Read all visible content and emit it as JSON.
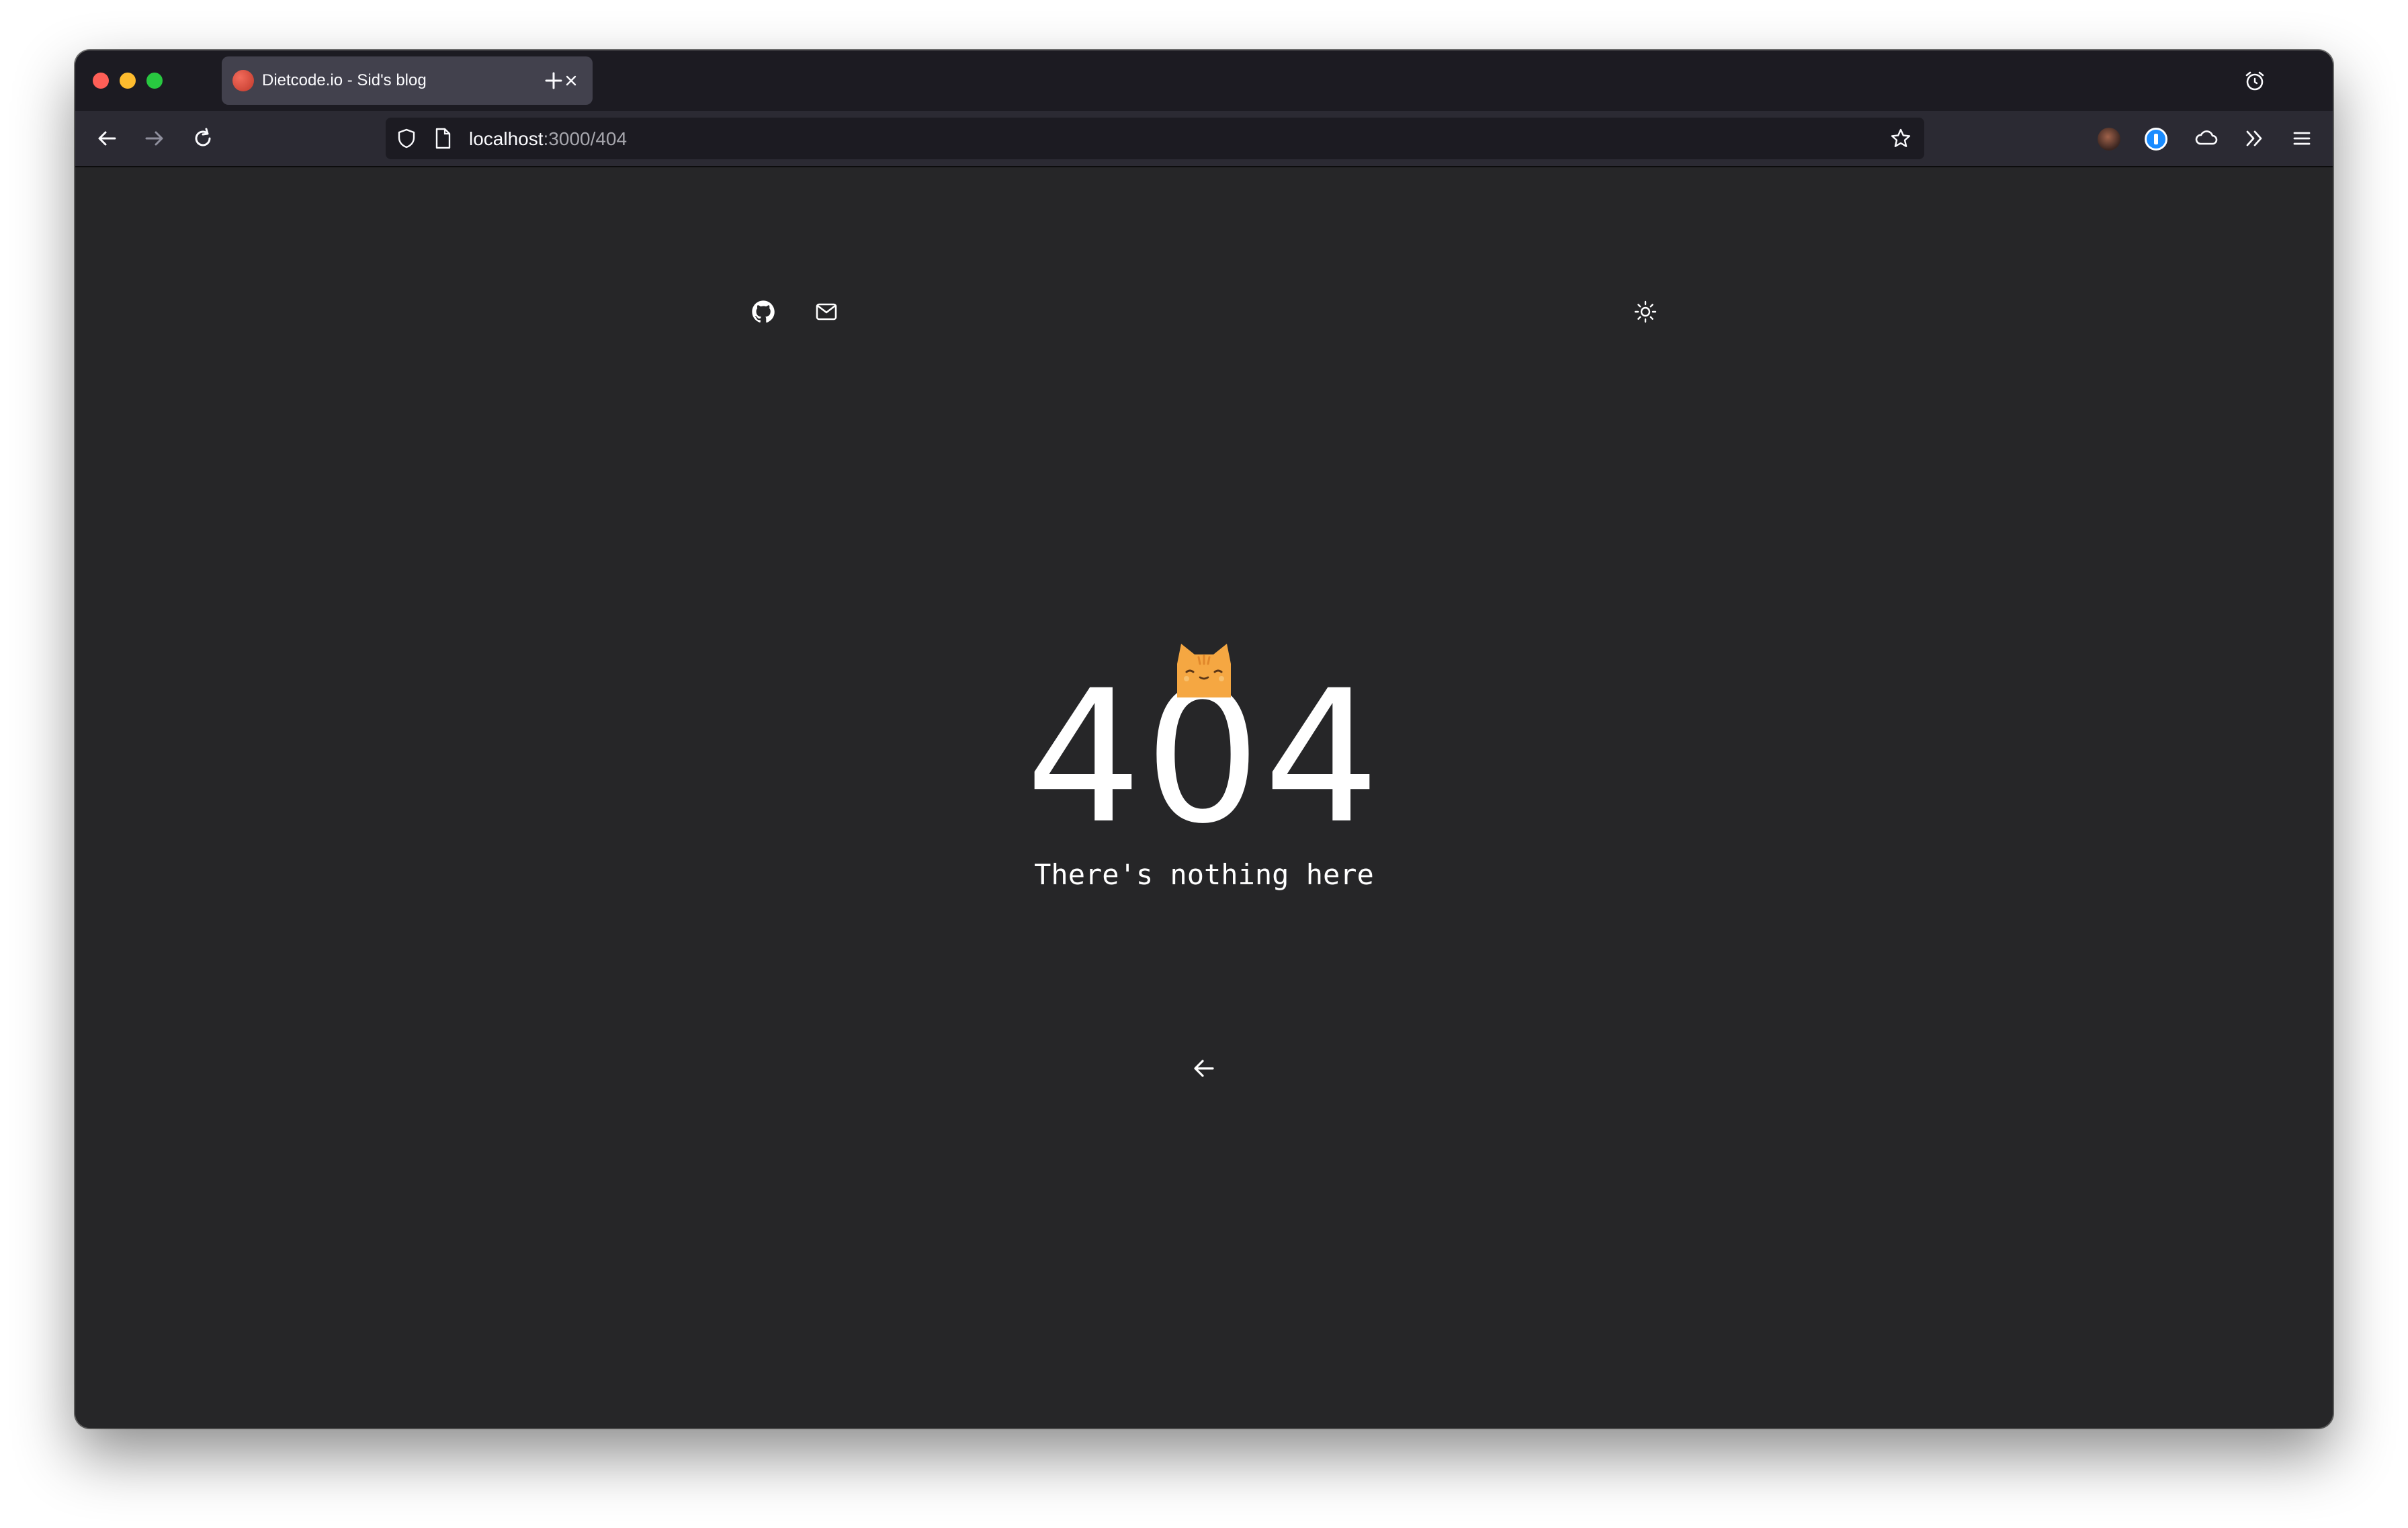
{
  "browser": {
    "tab": {
      "title": "Dietcode.io - Sid's blog",
      "favicon": "blog-favicon"
    },
    "toolbar": {
      "back": "arrow-left-icon",
      "forward": "arrow-right-icon",
      "reload": "reload-icon"
    },
    "urlbar": {
      "host": "localhost",
      "path": ":3000/404"
    },
    "extensions": [
      "profile-avatar",
      "1password-icon",
      "cloud-icon",
      "overflow-chevrons-icon",
      "hamburger-menu-icon"
    ]
  },
  "page": {
    "header_icons": [
      "github-icon",
      "mail-icon",
      "sun-icon"
    ],
    "error_code": "404",
    "message": "There's nothing here",
    "back_icon": "arrow-left-icon",
    "accent_color": "#f5a742"
  }
}
